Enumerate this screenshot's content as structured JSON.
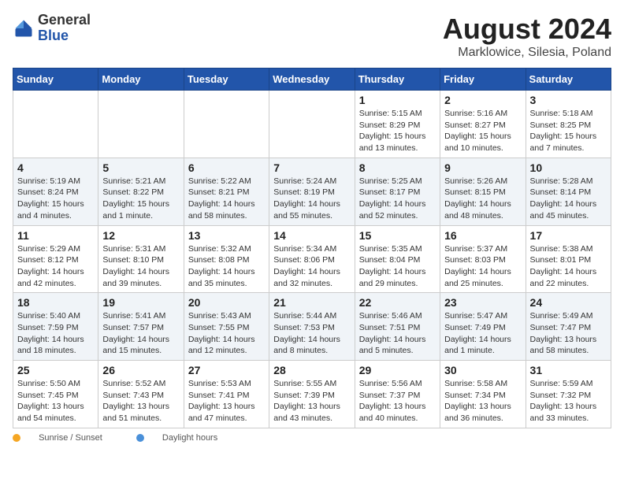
{
  "header": {
    "logo_general": "General",
    "logo_blue": "Blue",
    "month_year": "August 2024",
    "location": "Marklowice, Silesia, Poland"
  },
  "calendar": {
    "days_of_week": [
      "Sunday",
      "Monday",
      "Tuesday",
      "Wednesday",
      "Thursday",
      "Friday",
      "Saturday"
    ],
    "weeks": [
      [
        {
          "day": "",
          "info": ""
        },
        {
          "day": "",
          "info": ""
        },
        {
          "day": "",
          "info": ""
        },
        {
          "day": "",
          "info": ""
        },
        {
          "day": "1",
          "info": "Sunrise: 5:15 AM\nSunset: 8:29 PM\nDaylight: 15 hours\nand 13 minutes."
        },
        {
          "day": "2",
          "info": "Sunrise: 5:16 AM\nSunset: 8:27 PM\nDaylight: 15 hours\nand 10 minutes."
        },
        {
          "day": "3",
          "info": "Sunrise: 5:18 AM\nSunset: 8:25 PM\nDaylight: 15 hours\nand 7 minutes."
        }
      ],
      [
        {
          "day": "4",
          "info": "Sunrise: 5:19 AM\nSunset: 8:24 PM\nDaylight: 15 hours\nand 4 minutes."
        },
        {
          "day": "5",
          "info": "Sunrise: 5:21 AM\nSunset: 8:22 PM\nDaylight: 15 hours\nand 1 minute."
        },
        {
          "day": "6",
          "info": "Sunrise: 5:22 AM\nSunset: 8:21 PM\nDaylight: 14 hours\nand 58 minutes."
        },
        {
          "day": "7",
          "info": "Sunrise: 5:24 AM\nSunset: 8:19 PM\nDaylight: 14 hours\nand 55 minutes."
        },
        {
          "day": "8",
          "info": "Sunrise: 5:25 AM\nSunset: 8:17 PM\nDaylight: 14 hours\nand 52 minutes."
        },
        {
          "day": "9",
          "info": "Sunrise: 5:26 AM\nSunset: 8:15 PM\nDaylight: 14 hours\nand 48 minutes."
        },
        {
          "day": "10",
          "info": "Sunrise: 5:28 AM\nSunset: 8:14 PM\nDaylight: 14 hours\nand 45 minutes."
        }
      ],
      [
        {
          "day": "11",
          "info": "Sunrise: 5:29 AM\nSunset: 8:12 PM\nDaylight: 14 hours\nand 42 minutes."
        },
        {
          "day": "12",
          "info": "Sunrise: 5:31 AM\nSunset: 8:10 PM\nDaylight: 14 hours\nand 39 minutes."
        },
        {
          "day": "13",
          "info": "Sunrise: 5:32 AM\nSunset: 8:08 PM\nDaylight: 14 hours\nand 35 minutes."
        },
        {
          "day": "14",
          "info": "Sunrise: 5:34 AM\nSunset: 8:06 PM\nDaylight: 14 hours\nand 32 minutes."
        },
        {
          "day": "15",
          "info": "Sunrise: 5:35 AM\nSunset: 8:04 PM\nDaylight: 14 hours\nand 29 minutes."
        },
        {
          "day": "16",
          "info": "Sunrise: 5:37 AM\nSunset: 8:03 PM\nDaylight: 14 hours\nand 25 minutes."
        },
        {
          "day": "17",
          "info": "Sunrise: 5:38 AM\nSunset: 8:01 PM\nDaylight: 14 hours\nand 22 minutes."
        }
      ],
      [
        {
          "day": "18",
          "info": "Sunrise: 5:40 AM\nSunset: 7:59 PM\nDaylight: 14 hours\nand 18 minutes."
        },
        {
          "day": "19",
          "info": "Sunrise: 5:41 AM\nSunset: 7:57 PM\nDaylight: 14 hours\nand 15 minutes."
        },
        {
          "day": "20",
          "info": "Sunrise: 5:43 AM\nSunset: 7:55 PM\nDaylight: 14 hours\nand 12 minutes."
        },
        {
          "day": "21",
          "info": "Sunrise: 5:44 AM\nSunset: 7:53 PM\nDaylight: 14 hours\nand 8 minutes."
        },
        {
          "day": "22",
          "info": "Sunrise: 5:46 AM\nSunset: 7:51 PM\nDaylight: 14 hours\nand 5 minutes."
        },
        {
          "day": "23",
          "info": "Sunrise: 5:47 AM\nSunset: 7:49 PM\nDaylight: 14 hours\nand 1 minute."
        },
        {
          "day": "24",
          "info": "Sunrise: 5:49 AM\nSunset: 7:47 PM\nDaylight: 13 hours\nand 58 minutes."
        }
      ],
      [
        {
          "day": "25",
          "info": "Sunrise: 5:50 AM\nSunset: 7:45 PM\nDaylight: 13 hours\nand 54 minutes."
        },
        {
          "day": "26",
          "info": "Sunrise: 5:52 AM\nSunset: 7:43 PM\nDaylight: 13 hours\nand 51 minutes."
        },
        {
          "day": "27",
          "info": "Sunrise: 5:53 AM\nSunset: 7:41 PM\nDaylight: 13 hours\nand 47 minutes."
        },
        {
          "day": "28",
          "info": "Sunrise: 5:55 AM\nSunset: 7:39 PM\nDaylight: 13 hours\nand 43 minutes."
        },
        {
          "day": "29",
          "info": "Sunrise: 5:56 AM\nSunset: 7:37 PM\nDaylight: 13 hours\nand 40 minutes."
        },
        {
          "day": "30",
          "info": "Sunrise: 5:58 AM\nSunset: 7:34 PM\nDaylight: 13 hours\nand 36 minutes."
        },
        {
          "day": "31",
          "info": "Sunrise: 5:59 AM\nSunset: 7:32 PM\nDaylight: 13 hours\nand 33 minutes."
        }
      ]
    ]
  },
  "footer": {
    "sunrise_label": "Sunrise / Sunset",
    "daylight_label": "Daylight hours"
  }
}
